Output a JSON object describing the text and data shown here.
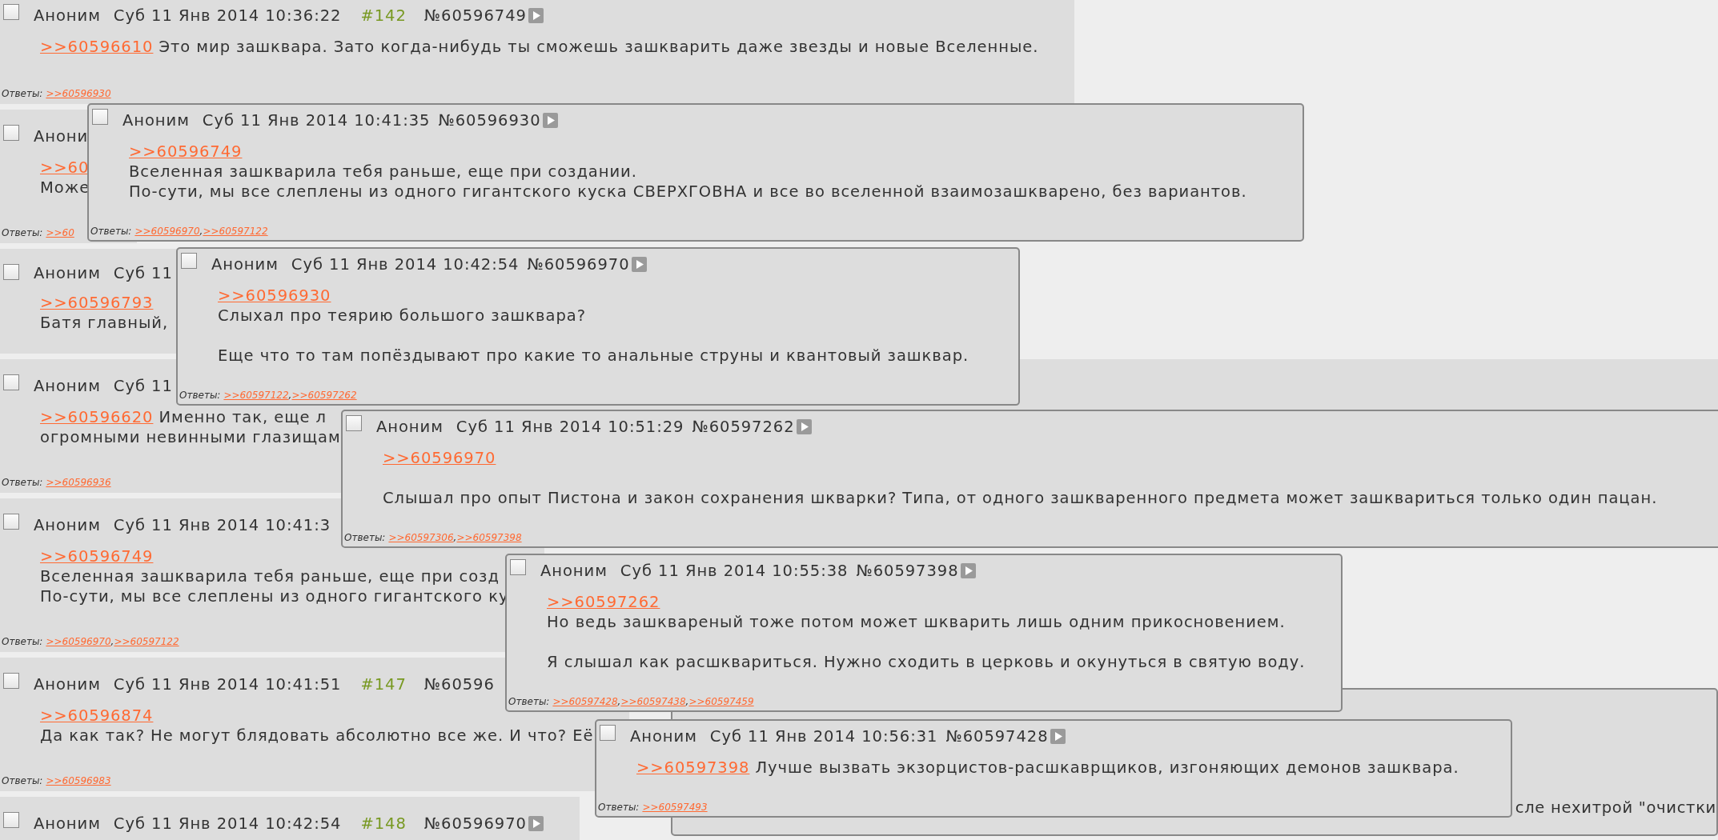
{
  "thread": {
    "posts": [
      {
        "checked": false,
        "name": "Аноним",
        "date": "Суб 11 Янв 2014 10:36:22",
        "number": "#142",
        "id": "№60596749",
        "play_icon": true,
        "lines": [
          {
            "kind": "line",
            "link": ">>60596610",
            "text": "Это мир зашквара. Зато когда-нибудь ты сможешь зашкварить даже звезды и новые Вселенные."
          }
        ],
        "replies": {
          "label": "Ответы:",
          "links": [
            ">>60596930"
          ]
        }
      },
      {
        "checked": false,
        "name": "Анони",
        "lines": [
          {
            "kind": "line",
            "link": ">>60"
          },
          {
            "kind": "line",
            "text": "Може"
          }
        ],
        "replies": {
          "label": "Ответы:",
          "links": [
            ">>60"
          ]
        }
      },
      {
        "checked": false,
        "name": "Аноним",
        "date": "Суб 11",
        "lines": [
          {
            "kind": "line",
            "link": ">>60596793"
          },
          {
            "kind": "line",
            "text": "Батя главный,"
          }
        ]
      },
      {
        "checked": false,
        "name": "Аноним",
        "date": "Суб 11",
        "lines": [
          {
            "kind": "line",
            "link": ">>60596620",
            "text": "Именно так, еще л"
          },
          {
            "kind": "line",
            "text": "огромными невинными глазищам"
          }
        ],
        "replies": {
          "label": "Ответы:",
          "links": [
            ">>60596936"
          ]
        }
      },
      {
        "checked": false,
        "name": "Аноним",
        "date": "Суб 11 Янв 2014 10:41:3",
        "lines": [
          {
            "kind": "line",
            "link": ">>60596749"
          },
          {
            "kind": "line",
            "text": "Вселенная зашкварила тебя раньше, еще при созд"
          },
          {
            "kind": "line",
            "text": "По-сути, мы все слеплены из одного гигантского ку"
          }
        ],
        "replies": {
          "label": "Ответы:",
          "separator": ",",
          "links": [
            ">>60596970",
            ">>60597122"
          ]
        }
      },
      {
        "checked": false,
        "name": "Аноним",
        "date": "Суб 11 Янв 2014 10:41:51",
        "number": "#147",
        "id": "№60596",
        "lines": [
          {
            "kind": "line",
            "link": ">>60596874"
          },
          {
            "kind": "line",
            "text": "Да как так? Не могут блядовать абсолютно все же. И что? Её"
          }
        ],
        "replies": {
          "label": "Ответы:",
          "links": [
            ">>60596983"
          ]
        }
      },
      {
        "checked": false,
        "name": "Аноним",
        "date": "Суб 11 Янв 2014 10:42:54",
        "number": "#148",
        "id": "№60596970",
        "play_icon": true
      }
    ]
  },
  "popups": [
    {
      "checked": false,
      "name": "Аноним",
      "date": "Суб 11 Янв 2014 10:41:35",
      "id": "№60596930",
      "play_icon": true,
      "lines": [
        {
          "kind": "line",
          "link": ">>60596749"
        },
        {
          "kind": "line",
          "text": "Вселенная зашкварила тебя раньше, еще при создании."
        },
        {
          "kind": "line",
          "text": "По-сути, мы все слеплены из одного гигантского куска СВЕРХГОВНА и все во вселенной взаимозашкварено, без вариантов."
        }
      ],
      "replies": {
        "label": "Ответы:",
        "separator": ",",
        "links": [
          ">>60596970",
          ">>60597122"
        ]
      }
    },
    {
      "checked": false,
      "name": "Аноним",
      "date": "Суб 11 Янв 2014 10:42:54",
      "id": "№60596970",
      "play_icon": true,
      "lines": [
        {
          "kind": "line",
          "link": ">>60596930"
        },
        {
          "kind": "line",
          "text": "Слыхал про теярию большого зашквара?"
        },
        {
          "kind": "gap"
        },
        {
          "kind": "line",
          "text": "Еще что то там попёздывают про какие то анальные струны и квантовый зашквар."
        }
      ],
      "replies": {
        "label": "Ответы:",
        "separator": ",",
        "links": [
          ">>60597122",
          ">>60597262"
        ]
      }
    },
    {
      "checked": false,
      "name": "Аноним",
      "date": "Суб 11 Янв 2014 10:51:29",
      "id": "№60597262",
      "play_icon": true,
      "lines": [
        {
          "kind": "line",
          "link": ">>60596970"
        },
        {
          "kind": "gap"
        },
        {
          "kind": "line",
          "text": "Слышал про опыт Пистона и закон сохранения шкварки? Типа, от одного зашкваренного предмета может зашквариться только один пацан."
        }
      ],
      "replies": {
        "label": "Ответы:",
        "separator": ",",
        "links": [
          ">>60597306",
          ">>60597398"
        ]
      }
    },
    {
      "checked": false,
      "name": "Аноним",
      "date": "Суб 11 Янв 2014 10:55:38",
      "id": "№60597398",
      "play_icon": true,
      "lines": [
        {
          "kind": "line",
          "link": ">>60597262"
        },
        {
          "kind": "line",
          "text": "Но ведь зашквареный тоже потом может шкварить лишь одним прикосновением."
        },
        {
          "kind": "gap"
        },
        {
          "kind": "line",
          "text": "Я слышал как расшквариться. Нужно сходить в церковь и окунуться в святую воду."
        }
      ],
      "replies": {
        "label": "Ответы:",
        "separator": ",",
        "links": [
          ">>60597428",
          ">>60597438",
          ">>60597459"
        ]
      }
    },
    {
      "checked": false,
      "name": "Аноним",
      "date": "Суб 11 Янв 2014 10:56:31",
      "id": "№60597428",
      "play_icon": true,
      "lines": [
        {
          "kind": "line",
          "link": ">>60597398",
          "text": "Лучше вызвать экзорцистов-расшкаврщиков, изгоняющих демонов зашквара."
        }
      ],
      "replies": {
        "label": "Ответы:",
        "links": [
          ">>60597493"
        ]
      }
    }
  ],
  "hidden_popup": {
    "text": "сле нехитрой \"очистки"
  }
}
